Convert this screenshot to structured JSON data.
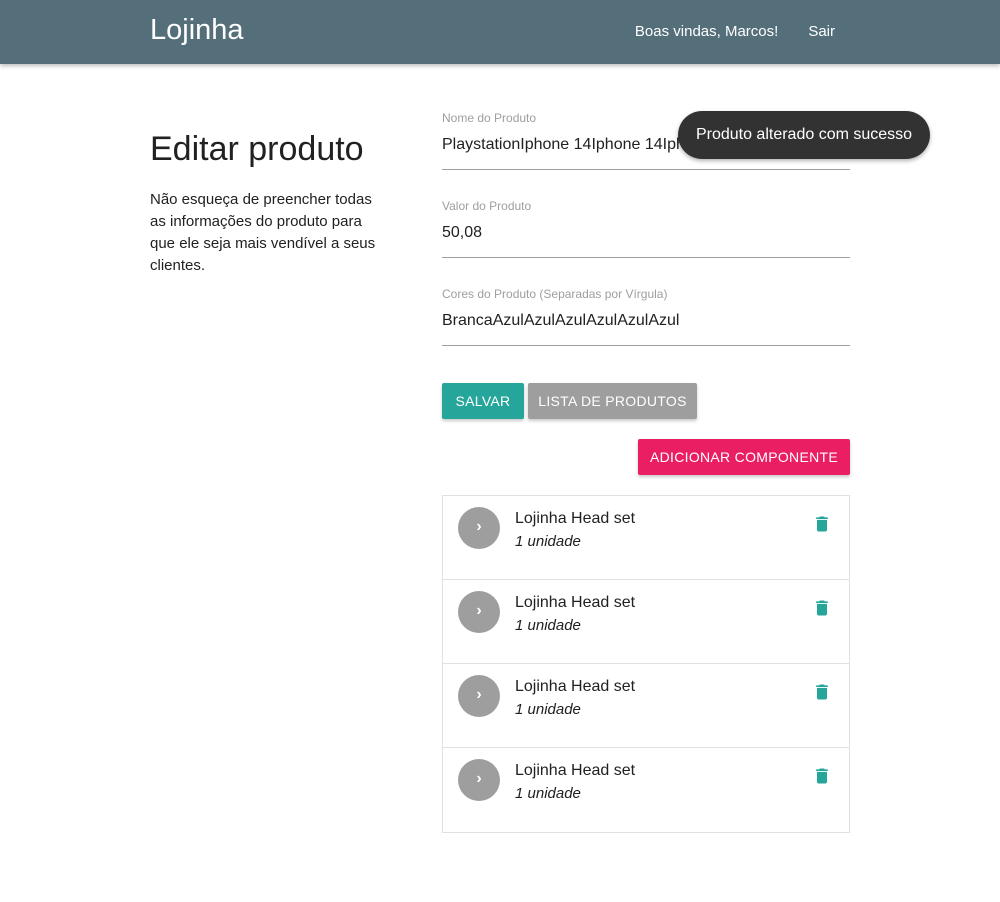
{
  "navbar": {
    "brand": "Lojinha",
    "welcome": "Boas vindas, Marcos!",
    "logout": "Sair",
    "color": "#546e7a"
  },
  "page": {
    "title": "Editar produto",
    "description": "Não esqueça de preencher todas as informações do produto para que ele seja mais vendível a seus clientes."
  },
  "form": {
    "name_label": "Nome do Produto",
    "name_value": "PlaystationIphone 14Iphone 14Iph",
    "price_label": "Valor do Produto",
    "price_value": "50,08",
    "colors_label": "Cores do Produto (Separadas por Vírgula)",
    "colors_value": "BrancaAzulAzulAzulAzulAzulAzul"
  },
  "buttons": {
    "save": "SALVAR",
    "list": "LISTA DE PRODUTOS",
    "add_component": "ADICIONAR COMPONENTE"
  },
  "components": [
    {
      "name": "Lojinha Head set",
      "quantity": "1 unidade",
      "avatar_icon": "chevron-right-icon",
      "action_icon": "trash-icon"
    },
    {
      "name": "Lojinha Head set",
      "quantity": "1 unidade",
      "avatar_icon": "chevron-right-icon",
      "action_icon": "trash-icon"
    },
    {
      "name": "Lojinha Head set",
      "quantity": "1 unidade",
      "avatar_icon": "chevron-right-icon",
      "action_icon": "trash-icon"
    },
    {
      "name": "Lojinha Head set",
      "quantity": "1 unidade",
      "avatar_icon": "chevron-right-icon",
      "action_icon": "trash-icon"
    }
  ],
  "toast": {
    "message": "Produto alterado com sucesso"
  },
  "colors": {
    "teal": "#26a69a",
    "grey": "#9e9e9e",
    "pink": "#e91e63",
    "toast_bg": "#323232"
  }
}
